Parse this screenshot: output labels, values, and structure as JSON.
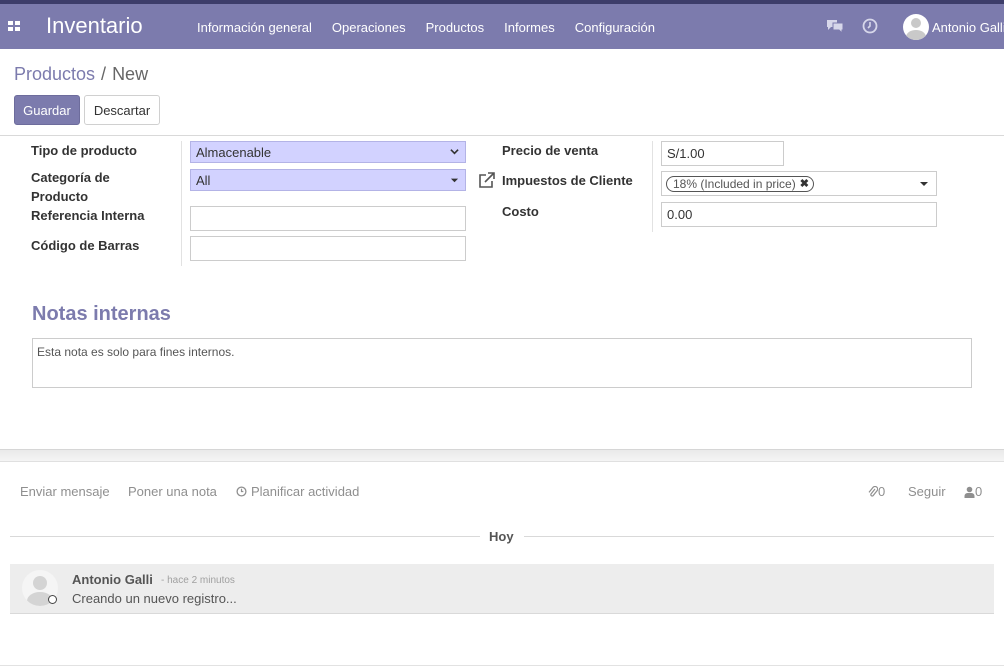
{
  "app": {
    "title": "Inventario",
    "menu": [
      "Información general",
      "Operaciones",
      "Productos",
      "Informes",
      "Configuración"
    ],
    "user_name": "Antonio Galli",
    "icons": [
      "apps-icon",
      "chat-icon",
      "clock-icon"
    ],
    "navbar_color": "#7c7bad",
    "accent_color": "#7c7bad"
  },
  "breadcrumb": {
    "parent": "Productos",
    "separator": "/",
    "current": "New"
  },
  "actions": {
    "save_label": "Guardar",
    "discard_label": "Descartar"
  },
  "form": {
    "product_type": {
      "label": "Tipo de producto",
      "value": "Almacenable"
    },
    "product_category": {
      "label": "Categoría de Producto",
      "value": "All"
    },
    "internal_reference": {
      "label": "Referencia Interna",
      "value": ""
    },
    "barcode": {
      "label": "Código de Barras",
      "value": ""
    },
    "sale_price": {
      "label": "Precio de venta",
      "value": "S/1.00"
    },
    "customer_taxes": {
      "label": "Impuestos de Cliente",
      "tags": [
        "18% (Included in price)"
      ]
    },
    "cost": {
      "label": "Costo",
      "value": "0.00"
    },
    "notes_title": "Notas internas",
    "notes_placeholder": "Esta nota es solo para fines internos."
  },
  "chatter": {
    "send_message": "Enviar mensaje",
    "log_note": "Poner una nota",
    "schedule_activity": "Planificar actividad",
    "attachments_count": "0",
    "follow_label": "Seguir",
    "followers_count": "0",
    "date_separator": "Hoy",
    "messages": [
      {
        "author": "Antonio Galli",
        "date": "- hace 2 minutos",
        "body": "Creando un nuevo registro..."
      }
    ]
  }
}
